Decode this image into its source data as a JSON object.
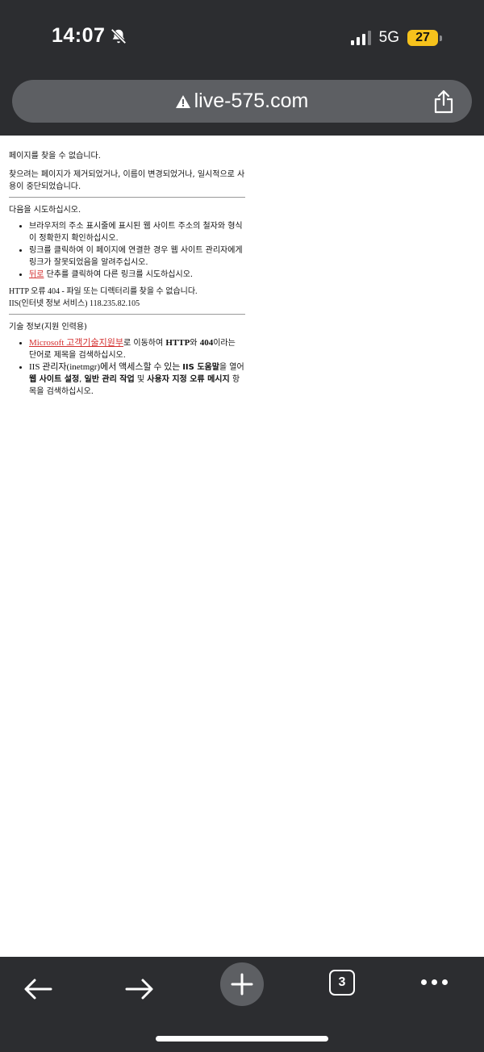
{
  "status": {
    "time": "14:07",
    "network": "5G",
    "battery": "27"
  },
  "browser": {
    "url": "live-575.com",
    "tab_count": "3"
  },
  "content": {
    "title": "페이지를 찾을 수 없습니다.",
    "description": "찾으려는 페이지가 제거되었거나, 이름이 변경되었거나, 일시적으로 사용이 중단되었습니다.",
    "try_heading": "다음을 시도하십시오.",
    "try_items": {
      "item1": "브라우저의 주소 표시줄에 표시된 웹 사이트 주소의 철자와 형식이 정확한지 확인하십시오.",
      "item2": "링크를 클릭하여 이 페이지에 연결한 경우 웹 사이트 관리자에게 링크가 잘못되었음을 알려주십시오.",
      "item3_link": "뒤로",
      "item3_text": " 단추를 클릭하여 다른 링크를 시도하십시오."
    },
    "error_line": "HTTP 오류 404 - 파일 또는 디렉터리를 찾을 수 없습니다.",
    "iis_line": "IIS(인터넷 정보 서비스) 118.235.82.105",
    "tech_heading": "기술 정보(지원 인력용)",
    "tech1": {
      "link": "Microsoft 고객기술지원부",
      "t1": "로 이동하여 ",
      "b1": "HTTP",
      "t2": "와 ",
      "b2": "404",
      "t3": "이라는 단어로 제목을 검색하십시오."
    },
    "tech2": {
      "t1": "IIS 관리자(inetmgr)에서 액세스할 수 있는 ",
      "b1": "IIS 도움말",
      "t2": "을 열어 ",
      "b2": "웹 사이트 설정",
      "t3": ", ",
      "b3": "일반 관리 작업",
      "t4": " 및 ",
      "b4": "사용자 지정 오류 메시지",
      "t5": " 항목을 검색하십시오."
    }
  },
  "icons": {
    "bell": "bell-slash-icon",
    "warning": "warning-icon",
    "share": "share-icon",
    "back": "arrow-left-icon",
    "forward": "arrow-right-icon",
    "new_tab": "plus-icon",
    "tabs": "tabs-icon",
    "more": "more-icon"
  },
  "colors": {
    "chrome_bg": "#2c2d30",
    "url_bar": "#5d5f63",
    "battery": "#f6c21c",
    "link": "#d32f2f"
  }
}
